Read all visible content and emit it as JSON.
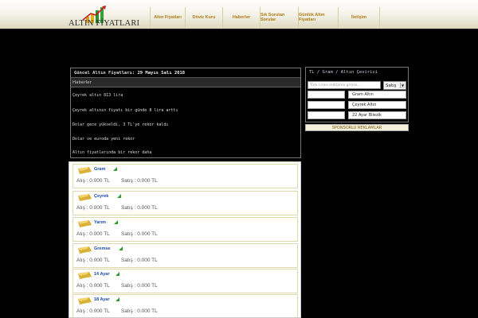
{
  "logo": {
    "text": "ALTIN FİYATLARI"
  },
  "nav": {
    "items": [
      {
        "label": "Altın Fiyatları"
      },
      {
        "label": "Döviz Kuru"
      },
      {
        "label": "Haberler"
      },
      {
        "label": "Sık Sorulan Sorular"
      },
      {
        "label": "Günlük Altın Fiyatları"
      },
      {
        "label": "İletişim"
      }
    ]
  },
  "news": {
    "header_prefix": "Güncel Altın Fiyatları:",
    "header_date": "29 Mayıs Salı 2018",
    "subheader": "Haberler",
    "lines": [
      "Çeyrek altın 813 lira",
      "Çeyrek altının fiyatı bir günde 8 lira arttı",
      "Dolar gece yükseldi, 3 TL'ye rekor kaldı",
      "Dolar ve euroda yeni rekor",
      "Altın fiyatlarında bir rekor daha"
    ]
  },
  "converter": {
    "title": "TL / Gram / Altın Çevirici",
    "input_placeholder": "Türk Lirası miktarını giriniz...",
    "select_value": "Satış",
    "rows": [
      {
        "label": "Gram Altın"
      },
      {
        "label": "Çeyrek Altın"
      },
      {
        "label": "22 Ayar Bilezik"
      }
    ]
  },
  "sponsor": {
    "label": "SPONSORLU REKLAMLAR"
  },
  "prices": [
    {
      "name": "Gram",
      "buy": "Alış : 0.000 TL",
      "sell": "Satış : 0.000 TL"
    },
    {
      "name": "Çeyrek",
      "buy": "Alış : 0.000 TL",
      "sell": "Satış : 0.000 TL"
    },
    {
      "name": "Yarım",
      "buy": "Alış : 0.000 TL",
      "sell": "Satış : 0.000 TL"
    },
    {
      "name": "Gremse",
      "buy": "Alış : 0.000 TL",
      "sell": "Satış : 0.000 TL"
    },
    {
      "name": "14 Ayar",
      "buy": "Alış : 0.000 TL",
      "sell": "Satış : 0.000 TL"
    },
    {
      "name": "18 Ayar",
      "buy": "Alış : 0.000 TL",
      "sell": "Satış : 0.000 TL"
    }
  ]
}
